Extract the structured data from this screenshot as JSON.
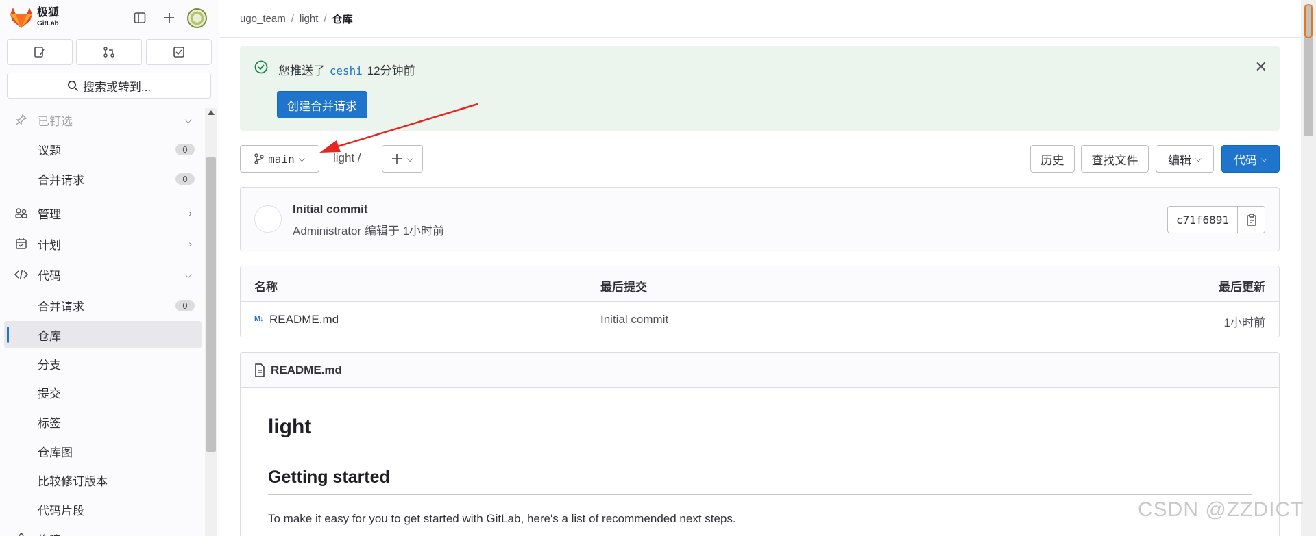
{
  "brand": {
    "name": "极狐",
    "sub": "GitLab"
  },
  "search": {
    "placeholder": "搜索或转到..."
  },
  "sidebar": {
    "pinned": "已钉选",
    "pinned_items": [
      {
        "label": "议题",
        "count": "0"
      },
      {
        "label": "合并请求",
        "count": "0"
      }
    ],
    "manage": "管理",
    "plan": "计划",
    "code": "代码",
    "code_items": [
      {
        "label": "合并请求",
        "count": "0"
      },
      {
        "label": "仓库"
      },
      {
        "label": "分支"
      },
      {
        "label": "提交"
      },
      {
        "label": "标签"
      },
      {
        "label": "仓库图"
      },
      {
        "label": "比较修订版本"
      },
      {
        "label": "代码片段"
      }
    ],
    "build": "构建"
  },
  "breadcrumb": [
    "ugo_team",
    "light",
    "仓库"
  ],
  "alert": {
    "prefix": "您推送了",
    "branch": "ceshi",
    "suffix": "12分钟前",
    "button": "创建合并请求"
  },
  "toolbar": {
    "branch": "main",
    "path": "light /",
    "history": "历史",
    "find_file": "查找文件",
    "edit": "编辑",
    "code": "代码"
  },
  "commit": {
    "title": "Initial commit",
    "author": "Administrator",
    "meta": "编辑于 1小时前",
    "sha": "c71f6891"
  },
  "files": {
    "headers": [
      "名称",
      "最后提交",
      "最后更新"
    ],
    "rows": [
      {
        "name": "README.md",
        "commit": "Initial commit",
        "updated": "1小时前"
      }
    ]
  },
  "readme": {
    "filename": "README.md",
    "h1": "light",
    "h2": "Getting started",
    "p": "To make it easy for you to get started with GitLab, here's a list of recommended next steps."
  },
  "watermark": "CSDN @ZZDICT",
  "colors": {
    "brand_blue": "#1f75cb",
    "alert_bg": "#ecf4ee",
    "success": "#108548",
    "annotation_arrow": "#e5251f"
  }
}
